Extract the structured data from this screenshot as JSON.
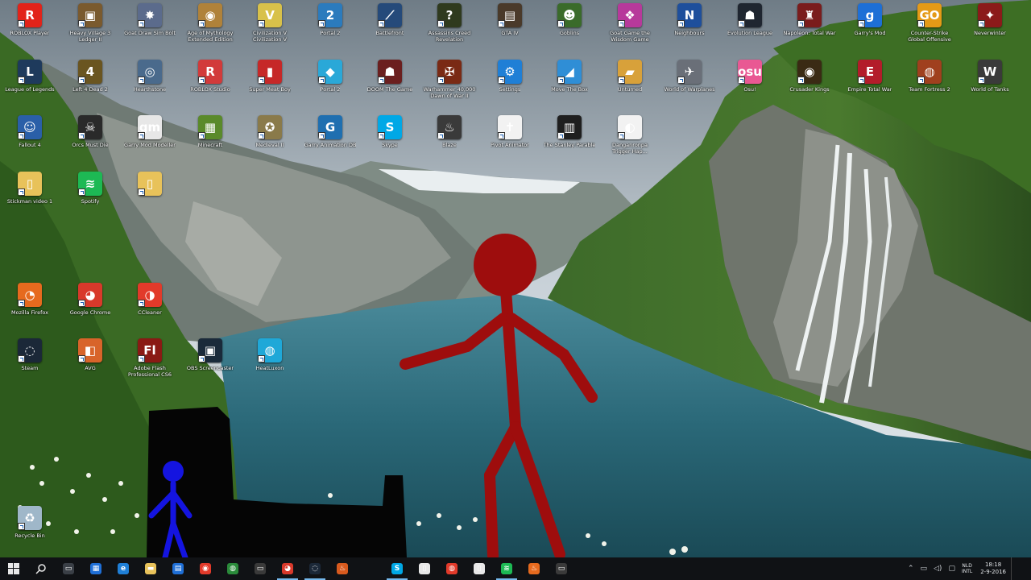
{
  "desktop": {
    "icons_row1": [
      {
        "label": "ROBLOX Player",
        "glyph": "R",
        "color": "#e2231a",
        "icon": "roblox-icon"
      },
      {
        "label": "Heavy Village 3 Ledger II",
        "glyph": "▣",
        "color": "#7a5a2e",
        "icon": "game-icon"
      },
      {
        "label": "Goat Draw Sim Bolt",
        "glyph": "✸",
        "color": "#5b6b8c",
        "icon": "game-icon"
      },
      {
        "label": "Age of Mythology Extended Edition",
        "glyph": "◉",
        "color": "#b0823a",
        "icon": "game-icon"
      },
      {
        "label": "Civilization V Civilization V",
        "glyph": "V",
        "color": "#d8c14a",
        "icon": "civ-icon"
      },
      {
        "label": "Portal 2",
        "glyph": "2",
        "color": "#2b7bbd",
        "icon": "portal-icon"
      },
      {
        "label": "Battlefront",
        "glyph": "⟋",
        "color": "#254a7a",
        "icon": "game-icon"
      },
      {
        "label": "Assassins Creed Revelation",
        "glyph": "?",
        "color": "#2f3a1e",
        "icon": "game-icon"
      },
      {
        "label": "GTA IV",
        "glyph": "▤",
        "color": "#4a3a2a",
        "icon": "game-icon"
      },
      {
        "label": "Goblins",
        "glyph": "☻",
        "color": "#3a6b2a",
        "icon": "game-icon"
      },
      {
        "label": "Goat Game the Wisdom Game",
        "glyph": "❖",
        "color": "#b7399b",
        "icon": "game-icon"
      },
      {
        "label": "Neighbours",
        "glyph": "N",
        "color": "#1e4f9c",
        "icon": "n-icon"
      },
      {
        "label": "Evolution League",
        "glyph": "☗",
        "color": "#1f2630",
        "icon": "game-icon"
      },
      {
        "label": "Napoleon: Total War",
        "glyph": "♜",
        "color": "#7a1c1c",
        "icon": "game-icon"
      },
      {
        "label": "Garry's Mod",
        "glyph": "g",
        "color": "#1d6fd6",
        "icon": "gmod-icon"
      },
      {
        "label": "Counter-Strike Global Offensive",
        "glyph": "GO",
        "color": "#e49a17",
        "icon": "csgo-icon"
      },
      {
        "label": "Neverwinter",
        "glyph": "✦",
        "color": "#8b1a1a",
        "icon": "game-icon"
      }
    ],
    "icons_row2": [
      {
        "label": "League of Legends",
        "glyph": "L",
        "color": "#1e3a5c",
        "icon": "lol-icon"
      },
      {
        "label": "Left 4 Dead 2",
        "glyph": "4",
        "color": "#6a5520",
        "icon": "game-icon"
      },
      {
        "label": "Hearthstone",
        "glyph": "◎",
        "color": "#4a6a8c",
        "icon": "hearthstone-icon"
      },
      {
        "label": "ROBLOX Studio",
        "glyph": "R",
        "color": "#d23a3a",
        "icon": "roblox-icon"
      },
      {
        "label": "Super Meat Boy",
        "glyph": "▮",
        "color": "#c62828",
        "icon": "game-icon"
      },
      {
        "label": "Portal 2",
        "glyph": "◆",
        "color": "#2aa8d8",
        "icon": "game-icon"
      },
      {
        "label": "DOOM The Game",
        "glyph": "☗",
        "color": "#6b1f1f",
        "icon": "game-icon"
      },
      {
        "label": "Warhammer 40,000 Dawn of War II",
        "glyph": "✠",
        "color": "#7a2a14",
        "icon": "game-icon"
      },
      {
        "label": "Settings",
        "glyph": "⚙",
        "color": "#1f7fd6",
        "icon": "settings-icon"
      },
      {
        "label": "Move The Box",
        "glyph": "◢",
        "color": "#2f8ed6",
        "icon": "game-icon"
      },
      {
        "label": "Unturned",
        "glyph": "▰",
        "color": "#d8a13a",
        "icon": "game-icon"
      },
      {
        "label": "World of Warplanes",
        "glyph": "✈",
        "color": "#6a6f78",
        "icon": "game-icon"
      },
      {
        "label": "Osu!",
        "glyph": "osu",
        "color": "#e95893",
        "icon": "osu-icon"
      },
      {
        "label": "Crusader Kings",
        "glyph": "◉",
        "color": "#3a2a14",
        "icon": "game-icon"
      },
      {
        "label": "Empire Total War",
        "glyph": "E",
        "color": "#b31c2a",
        "icon": "game-icon"
      },
      {
        "label": "Team Fortress 2",
        "glyph": "◍",
        "color": "#a0401e",
        "icon": "tf2-icon"
      },
      {
        "label": "World of Tanks",
        "glyph": "W",
        "color": "#3a3a3a",
        "icon": "wot-icon"
      }
    ],
    "icons_row3": [
      {
        "label": "Fallout 4",
        "glyph": "☺",
        "color": "#2a5fa8",
        "icon": "fallout-icon"
      },
      {
        "label": "Orcs Must Die",
        "glyph": "☠",
        "color": "#2a2a2a",
        "icon": "game-icon"
      },
      {
        "label": "Garry Mod Modeller",
        "glyph": "gm",
        "color": "#e7e7e7",
        "icon": "game-icon"
      },
      {
        "label": "Minecraft",
        "glyph": "▦",
        "color": "#5a8a2a",
        "icon": "minecraft-icon"
      },
      {
        "label": "Medieval II",
        "glyph": "✪",
        "color": "#8a7a4a",
        "icon": "game-icon"
      },
      {
        "label": "Garry Animation DB",
        "glyph": "G",
        "color": "#1f6fb0",
        "icon": "game-icon"
      },
      {
        "label": "Skype",
        "glyph": "S",
        "color": "#00a8e6",
        "icon": "skype-icon"
      },
      {
        "label": "Blaze",
        "glyph": "♨",
        "color": "#3a3a3a",
        "icon": "game-icon"
      },
      {
        "label": "Pivot Animator",
        "glyph": "✝",
        "color": "#f2f2f2",
        "icon": "pivot-icon"
      },
      {
        "label": "The Stanley Parable",
        "glyph": "▥",
        "color": "#1f1f1f",
        "icon": "game-icon"
      },
      {
        "label": "Danganronpa Trigger Hap...",
        "glyph": "◐",
        "color": "#f2f2f2",
        "icon": "game-icon"
      }
    ],
    "icons_col_left": [
      {
        "label": "Stickman video 1",
        "glyph": "▯",
        "color": "#e8c25a",
        "icon": "folder-icon"
      },
      {
        "label": "Spotify",
        "glyph": "≋",
        "color": "#1db954",
        "icon": "spotify-icon"
      },
      {
        "label": "",
        "glyph": "▯",
        "color": "#e8c25a",
        "icon": "folder-icon"
      },
      {
        "label": "Mozilla Firefox",
        "glyph": "◔",
        "color": "#e66a1e",
        "icon": "firefox-icon"
      },
      {
        "label": "Google Chrome",
        "glyph": "◕",
        "color": "#d8392b",
        "icon": "chrome-icon"
      },
      {
        "label": "CCleaner",
        "glyph": "◑",
        "color": "#e23a2a",
        "icon": "ccleaner-icon"
      },
      {
        "label": "Steam",
        "glyph": "◌",
        "color": "#1b2838",
        "icon": "steam-icon"
      },
      {
        "label": "AVG",
        "glyph": "◧",
        "color": "#d8642a",
        "icon": "avg-icon"
      },
      {
        "label": "Adobe Flash Professional CS6",
        "glyph": "Fl",
        "color": "#8a1a14",
        "icon": "flash-icon"
      },
      {
        "label": "OBS Screencaster",
        "glyph": "▣",
        "color": "#1a2a3a",
        "icon": "obs-icon"
      },
      {
        "label": "HeatLuxon",
        "glyph": "◍",
        "color": "#1fa8d8",
        "icon": "game-icon"
      },
      {
        "label": "Recycle Bin",
        "glyph": "♻",
        "color": "#9fb7c9",
        "icon": "recycle-bin-icon"
      }
    ]
  },
  "taskbar": {
    "start_icon": "windows-start-icon",
    "clock_time": "18:18",
    "clock_date": "2-9-2016",
    "lang_top": "NLD",
    "lang_bottom": "INTL",
    "apps": [
      {
        "glyph": "▭",
        "color": "#3a3f46",
        "icon": "task-view-icon"
      },
      {
        "glyph": "▦",
        "color": "#1f6fd6",
        "icon": "store-icon"
      },
      {
        "glyph": "e",
        "color": "#1f7fd6",
        "icon": "edge-icon"
      },
      {
        "glyph": "▬",
        "color": "#e8c25a",
        "icon": "file-explorer-icon"
      },
      {
        "glyph": "▤",
        "color": "#1f6fd6",
        "icon": "app-icon"
      },
      {
        "glyph": "◉",
        "color": "#e23a2a",
        "icon": "app-icon"
      },
      {
        "glyph": "◍",
        "color": "#2a8a3a",
        "icon": "app-icon"
      },
      {
        "glyph": "▭",
        "color": "#3a3a3a",
        "icon": "app-icon"
      },
      {
        "glyph": "◕",
        "color": "#d8392b",
        "icon": "chrome-icon"
      },
      {
        "glyph": "◌",
        "color": "#1b2838",
        "icon": "steam-icon"
      },
      {
        "glyph": "♨",
        "color": "#d85a1e",
        "icon": "app-icon"
      },
      {
        "glyph": "",
        "color": "#101215",
        "icon": "app-icon"
      },
      {
        "glyph": "S",
        "color": "#00a8e6",
        "icon": "skype-icon"
      },
      {
        "glyph": "▯",
        "color": "#e8e8e8",
        "icon": "notepad-icon"
      },
      {
        "glyph": "◍",
        "color": "#e23a2a",
        "icon": "app-icon"
      },
      {
        "glyph": "▯",
        "color": "#e8e8e8",
        "icon": "notepad-icon"
      },
      {
        "glyph": "≋",
        "color": "#1db954",
        "icon": "spotify-icon"
      },
      {
        "glyph": "♨",
        "color": "#e66a1e",
        "icon": "app-icon"
      },
      {
        "glyph": "▭",
        "color": "#3a3a3a",
        "icon": "app-icon"
      }
    ]
  }
}
